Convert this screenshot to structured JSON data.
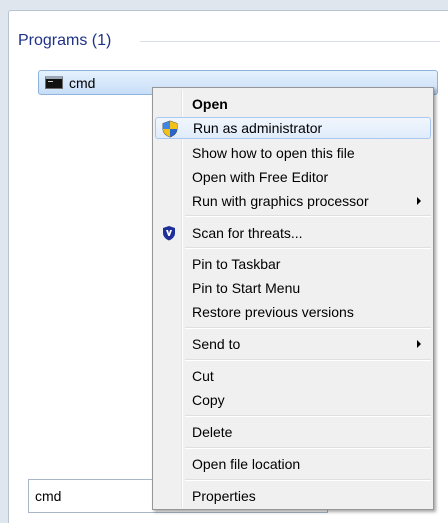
{
  "programs": {
    "header": "Programs (1)",
    "items": [
      {
        "label": "cmd",
        "icon": "command-prompt-icon"
      }
    ]
  },
  "context_menu": {
    "items": [
      {
        "label": "Open",
        "bold": true
      },
      {
        "label": "Run as administrator",
        "icon": "uac-shield-icon",
        "hovered": true
      },
      {
        "label": "Show how to open this file"
      },
      {
        "label": "Open with Free Editor"
      },
      {
        "label": "Run with graphics processor",
        "submenu": true
      },
      {
        "label": "Scan for threats...",
        "icon": "antivirus-shield-icon"
      },
      {
        "label": "Pin to Taskbar"
      },
      {
        "label": "Pin to Start Menu"
      },
      {
        "label": "Restore previous versions"
      },
      {
        "label": "Send to",
        "submenu": true
      },
      {
        "label": "Cut"
      },
      {
        "label": "Copy"
      },
      {
        "label": "Delete"
      },
      {
        "label": "Open file location"
      },
      {
        "label": "Properties"
      }
    ]
  },
  "search": {
    "value": "cmd"
  },
  "colors": {
    "header_text": "#1e3287",
    "highlight_border": "#8fb3df",
    "menu_background": "#f0f0f0"
  }
}
